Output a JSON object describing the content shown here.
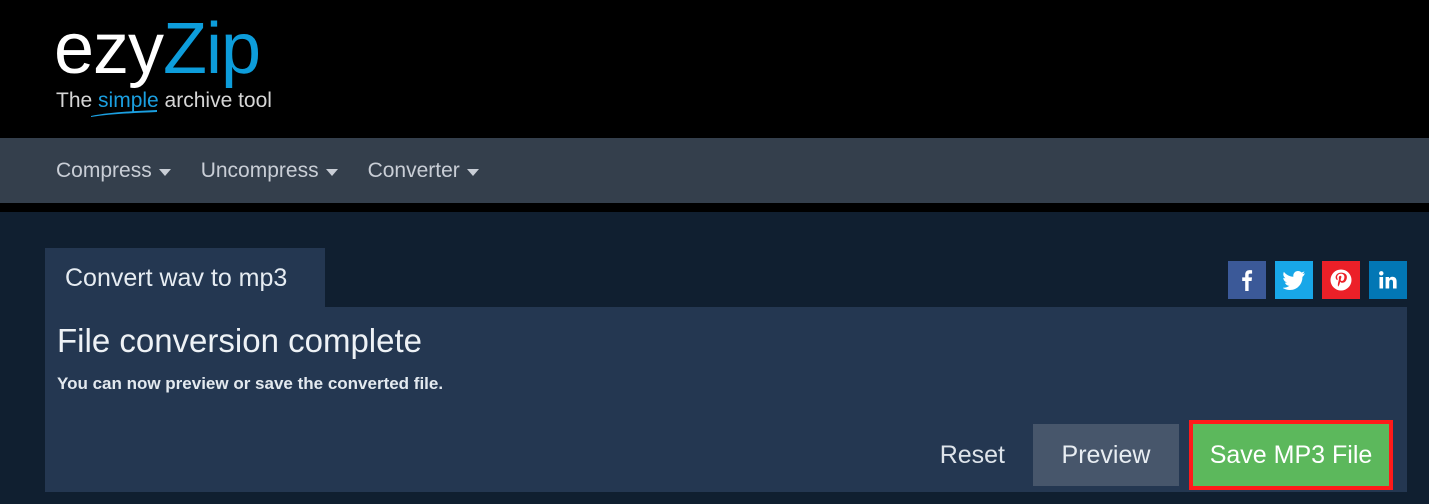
{
  "brand": {
    "logo_primary": "ezy",
    "logo_secondary": "Zip",
    "tagline_before": "The ",
    "tagline_highlight": "simple",
    "tagline_after": " archive tool",
    "accent_blue": "#0d9ddb"
  },
  "nav": {
    "items": [
      {
        "label": "Compress",
        "icon": "chevron-down-icon"
      },
      {
        "label": "Uncompress",
        "icon": "chevron-down-icon"
      },
      {
        "label": "Converter",
        "icon": "chevron-down-icon"
      }
    ]
  },
  "tab": {
    "label": "Convert wav to mp3"
  },
  "panel": {
    "heading": "File conversion complete",
    "subtitle": "You can now preview or save the converted file."
  },
  "actions": {
    "reset_label": "Reset",
    "preview_label": "Preview",
    "save_label": "Save MP3 File",
    "save_button_color": "#5cb85c",
    "save_highlight_color": "#ff1a1a",
    "preview_button_color": "#47566b"
  },
  "social": [
    {
      "name": "facebook-icon",
      "label": "f",
      "color": "#3b5998"
    },
    {
      "name": "twitter-icon",
      "label": "t",
      "color": "#18a7e8"
    },
    {
      "name": "pinterest-icon",
      "label": "p",
      "color": "#ec2028"
    },
    {
      "name": "linkedin-icon",
      "label": "in",
      "color": "#0277b5"
    }
  ]
}
